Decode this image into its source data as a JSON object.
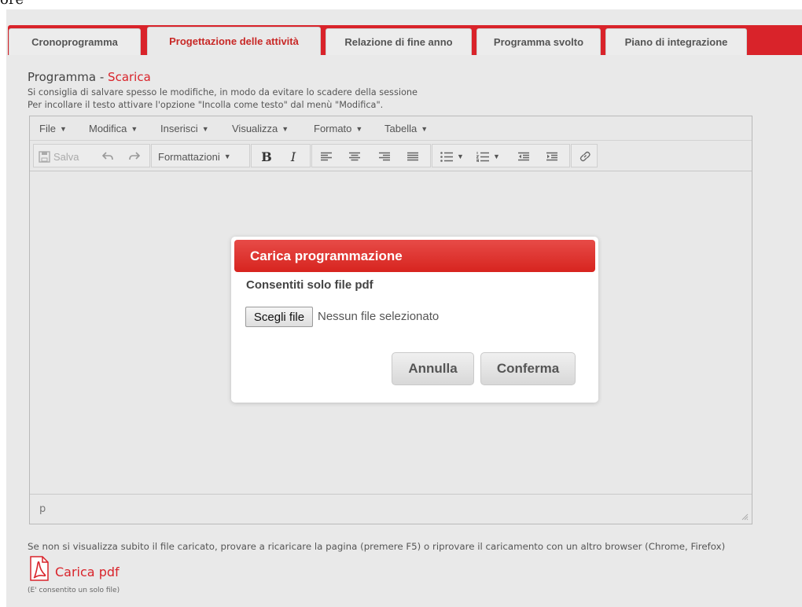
{
  "top_fragment": "ore",
  "tabs": [
    {
      "label": "Cronoprogramma",
      "active": false
    },
    {
      "label": "Progettazione delle attività",
      "active": true
    },
    {
      "label": "Relazione di fine anno",
      "active": false
    },
    {
      "label": "Programma svolto",
      "active": false
    },
    {
      "label": "Piano di integrazione",
      "active": false
    }
  ],
  "section": {
    "title": "Programma",
    "separator": " - ",
    "download_link": "Scarica",
    "notes": [
      "Si consiglia di salvare spesso le modifiche, in modo da evitare lo scadere della sessione",
      "Per incollare il testo attivare l'opzione \"Incolla come testo\" dal menù \"Modifica\"."
    ]
  },
  "editor": {
    "menus": [
      "File",
      "Modifica",
      "Inserisci",
      "Visualizza",
      "Formato",
      "Tabella"
    ],
    "toolbar": {
      "save_label": "Salva",
      "formats_label": "Formattazioni",
      "bold": "B",
      "italic": "I"
    },
    "status_path": "p"
  },
  "modal": {
    "title": "Carica programmazione",
    "subtitle": "Consentiti solo file pdf",
    "choose_file_label": "Scegli file",
    "file_status": "Nessun file selezionato",
    "cancel_label": "Annulla",
    "confirm_label": "Conferma"
  },
  "footer": {
    "note": "Se non si visualizza subito il file caricato, provare a ricaricare la pagina (premere F5) o riprovare il caricamento con un altro browser (Chrome, Firefox)",
    "upload_label": "Carica pdf",
    "single_file_note": "(E' consentito un solo file)"
  },
  "colors": {
    "brand_red": "#d9232a",
    "background": "#e9e9e9"
  }
}
